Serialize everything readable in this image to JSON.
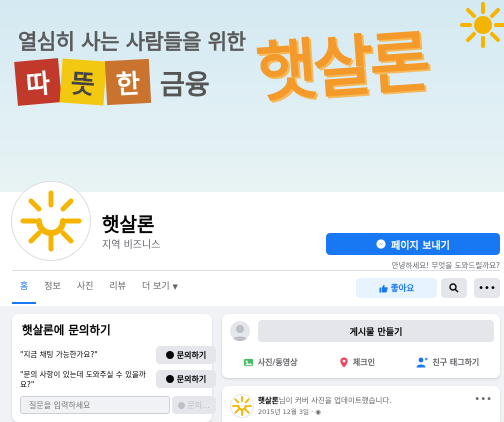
{
  "cover": {
    "tagline": "열심히 사는 사람들을 위한",
    "tiles": [
      "따",
      "뜻",
      "한"
    ],
    "tiles_after": "금융",
    "brand": "햇살론"
  },
  "profile": {
    "name": "햇살론",
    "category": "지역 비즈니스",
    "message_button": "페이지 보내기",
    "message_hint": "안녕하세요! 무엇을 도와드릴까요?"
  },
  "tabs": [
    "홈",
    "정보",
    "사진",
    "리뷰",
    "더 보기"
  ],
  "actions": {
    "like": "좋아요",
    "search_icon": "search-icon",
    "more_icon": "more-icon"
  },
  "ask_card": {
    "title": "햇살론에 문의하기",
    "faqs": [
      {
        "question": "\"지금 채팅 가능한가요?\"",
        "button": "문의하기"
      },
      {
        "question": "\"문의 사항이 있는데 도와주실 수 있을까요?\"",
        "button": "문의하기"
      }
    ],
    "input_placeholder": "질문을 입력하세요",
    "send_button": "문의..."
  },
  "create_post": {
    "button": "게시물 만들기",
    "actions": [
      "사진/동영상",
      "체크인",
      "친구 태그하기"
    ]
  },
  "feed": {
    "author": "햇살론",
    "text_suffix": "님이 커버 사진을 업데이트했습니다.",
    "date": "2015년 12월 3일 · "
  },
  "colors": {
    "primary": "#1877f2",
    "brand_orange": "#f49a2a",
    "sun": "#f5b400"
  }
}
